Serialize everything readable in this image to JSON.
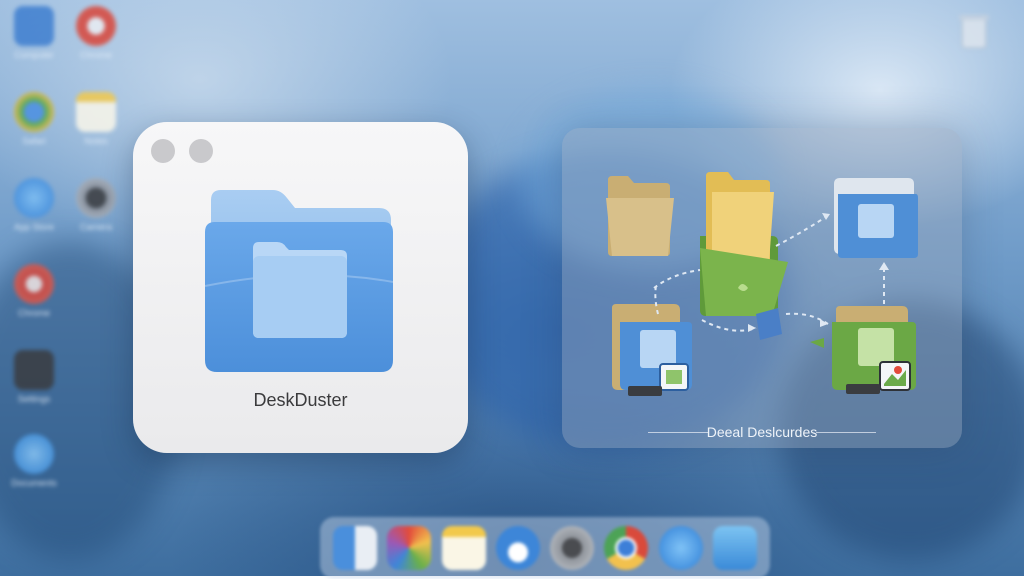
{
  "app": {
    "name": "DeskDuster"
  },
  "preview": {
    "caption": "Deeal Deslcurdes"
  },
  "desktop": {
    "icons": [
      {
        "label": "Computer"
      },
      {
        "label": "Chrome"
      },
      {
        "label": "Safari"
      },
      {
        "label": "Chrome"
      },
      {
        "label": "Settings"
      },
      {
        "label": "App Store"
      },
      {
        "label": "Notes"
      },
      {
        "label": "Documents"
      },
      {
        "label": "Camera"
      }
    ],
    "trash_label": "Recycle Bin"
  },
  "dock": {
    "items": [
      "finder-icon",
      "photos-icon",
      "notes-icon",
      "cloud-icon",
      "settings-icon",
      "chrome-icon",
      "app-store-icon",
      "files-icon"
    ]
  },
  "colors": {
    "folder_blue": "#5a9be0",
    "folder_blue_light": "#9cc6f0",
    "card_bg": "#f2f2f4"
  }
}
